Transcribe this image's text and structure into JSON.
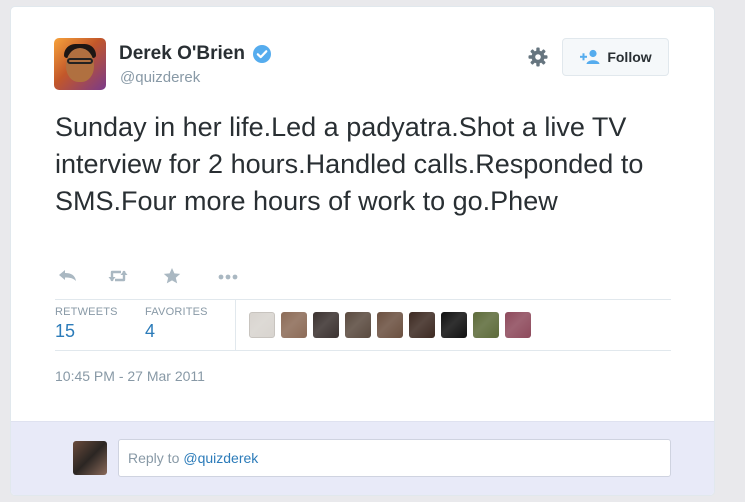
{
  "author": {
    "name": "Derek O'Brien",
    "handle": "@quizderek",
    "verified_icon": "verified-badge-icon"
  },
  "header": {
    "settings_icon": "gear-icon",
    "follow_label": "Follow",
    "follow_icon": "add-user-icon"
  },
  "tweet": {
    "text": "Sunday in her life.Led a padyatra.Shot a live TV interview for 2 hours.Handled calls.Responded to SMS.Four more hours of work to go.Phew"
  },
  "actions": [
    "reply-icon",
    "retweet-icon",
    "favorite-star-icon",
    "more-dots-icon"
  ],
  "stats": {
    "retweets_label": "RETWEETS",
    "retweets_value": "15",
    "favorites_label": "FAVORITES",
    "favorites_value": "4"
  },
  "favoriters": {
    "count": 9,
    "thumb_colors": [
      "#d8d4cf",
      "#8c6b57",
      "#3b3230",
      "#5a4a3f",
      "#6b5040",
      "#3d2a22",
      "#111111",
      "#5d6b3a",
      "#8e4a5c"
    ]
  },
  "timestamp": "10:45 PM - 27 Mar 2011",
  "reply": {
    "prefix": "Reply to",
    "mention": "@quizderek"
  },
  "colors": {
    "link_blue": "#2b7bb9",
    "verified_blue": "#55acee",
    "muted_gray": "#8899a6",
    "text_dark": "#292f33",
    "reply_bg": "#e8eaf8"
  }
}
